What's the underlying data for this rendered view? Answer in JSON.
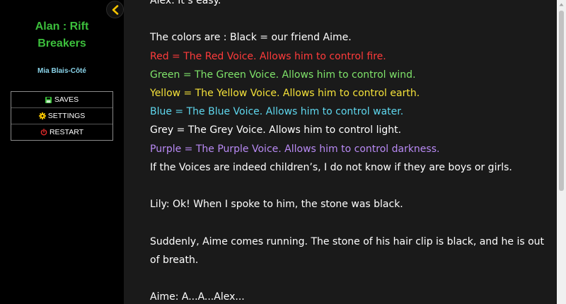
{
  "sidebar": {
    "title_line1": "Alan : Rift",
    "title_line2": "Breakers",
    "author": "Mia Blais-Côté",
    "menu": {
      "saves": "SAVES",
      "settings": "SETTINGS",
      "restart": "RESTART"
    }
  },
  "icons": {
    "back": "chevron-left-icon",
    "saves": "floppy-disk-icon",
    "settings": "gear-icon",
    "restart": "power-icon"
  },
  "colors": {
    "title": "#3cbf3c",
    "author": "#8ad4ea",
    "back_chevron": "#f2c200",
    "red": "#ff3b3b",
    "green": "#7fe36a",
    "yellow": "#f5e23a",
    "blue": "#5fd8ef",
    "grey": "#ffffff",
    "purple": "#b98af5"
  },
  "passage": {
    "line0": "Alex: It’s easy.",
    "line1": "The colors are : Black = our friend Aime.",
    "red": "Red = The Red Voice. Allows him to control fire.",
    "green": "Green = The Green Voice. Allows him to control wind.",
    "yellow": "Yellow = The Yellow Voice. Allows him to control earth.",
    "blue": "Blue = The Blue Voice. Allows him to control water.",
    "grey": "Grey = The Grey Voice. Allows him to control light.",
    "purple": "Purple = The Purple Voice. Allows him to control darkness.",
    "voices": "If the Voices are indeed children’s, I do not know if they are boys or girls.",
    "lily": "Lily: Ok! When I spoke to him, the stone was black.",
    "suddenly_a": "Suddenly, Aime comes running. The stone of his hair clip is black, and he is out",
    "suddenly_b": "of breath.",
    "aime": "Aime: A...A...Alex..."
  }
}
